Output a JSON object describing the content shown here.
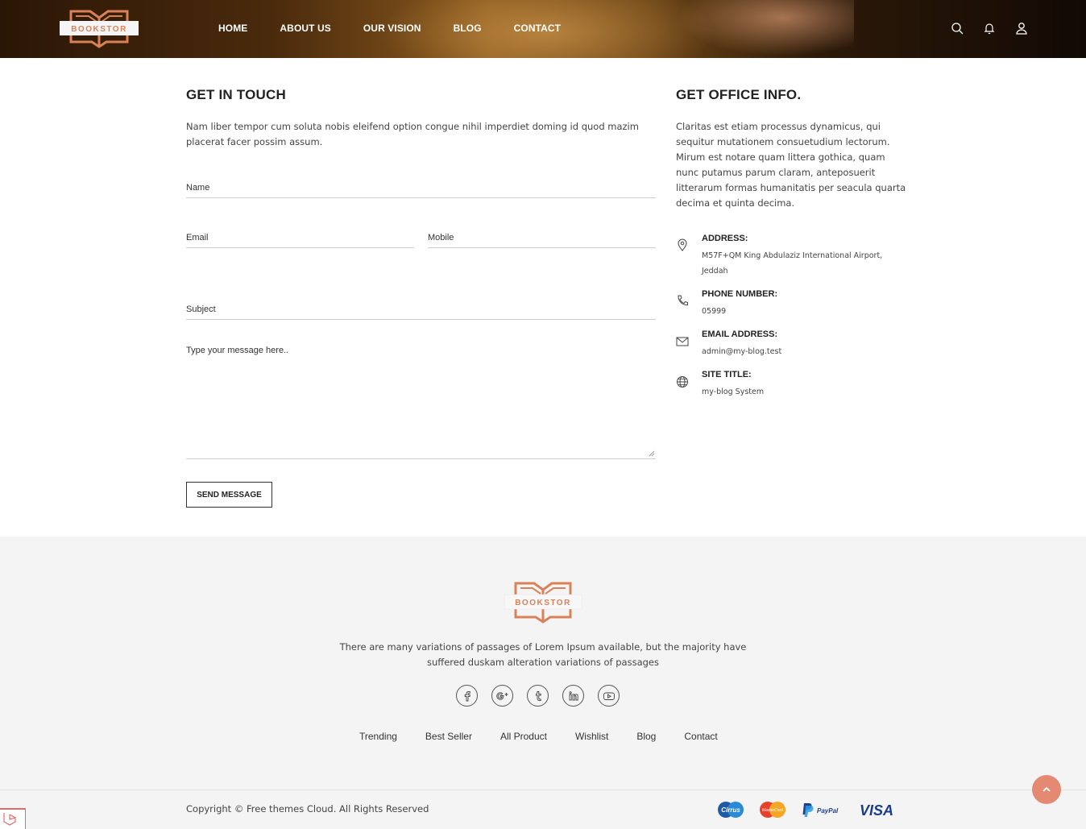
{
  "header": {
    "logo_text": "BOOKSTOR",
    "nav": [
      "HOME",
      "ABOUT US",
      "OUR VISION",
      "BLOG",
      "CONTACT"
    ],
    "icons": [
      "search-icon",
      "bell-icon",
      "user-icon"
    ]
  },
  "contact": {
    "title": "GET IN TOUCH",
    "intro": "Nam liber tempor cum soluta nobis eleifend option congue nihil imperdiet doming id quod mazim placerat facer possim assum.",
    "fields": {
      "name": "Name",
      "email": "Email",
      "mobile": "Mobile",
      "subject": "Subject",
      "message": "Type your message here.."
    },
    "send_label": "SEND MESSAGE"
  },
  "office": {
    "title": "GET OFFICE INFO.",
    "desc": "Claritas est etiam processus dynamicus, qui sequitur mutationem consuetudium lectorum. Mirum est notare quam littera gothica, quam nunc putamus parum claram, anteposuerit litterarum formas humanitatis per seacula quarta decima et quinta decima.",
    "items": [
      {
        "label": "ADDRESS:",
        "value": "M57F+QM King Abdulaziz International Airport, Jeddah",
        "icon": "location-icon"
      },
      {
        "label": "PHONE NUMBER:",
        "value": "05999",
        "icon": "phone-icon"
      },
      {
        "label": "EMAIL ADDRESS:",
        "value": "admin@my-blog.test",
        "icon": "mail-icon"
      },
      {
        "label": "SITE TITLE:",
        "value": "my-blog System",
        "icon": "globe-icon"
      }
    ]
  },
  "footer": {
    "logo_text": "BOOKSTOR",
    "text": "There are many variations of passages of Lorem Ipsum available, but the majority have suffered duskam alteration variations of passages",
    "social": [
      "facebook-icon",
      "google-plus-icon",
      "tumblr-icon",
      "linkedin-icon",
      "youtube-icon"
    ],
    "links": [
      "Trending",
      "Best Seller",
      "All Product",
      "Wishlist",
      "Blog",
      "Contact"
    ],
    "copyright": "Copyright © Free themes Cloud. All Rights Reserved",
    "payments": [
      "Cirrus",
      "MasterCard",
      "PayPal",
      "VISA"
    ]
  },
  "colors": {
    "accent": "#e0805f",
    "footer_bg": "#f4f4f4",
    "to_top": "#e58a72"
  }
}
